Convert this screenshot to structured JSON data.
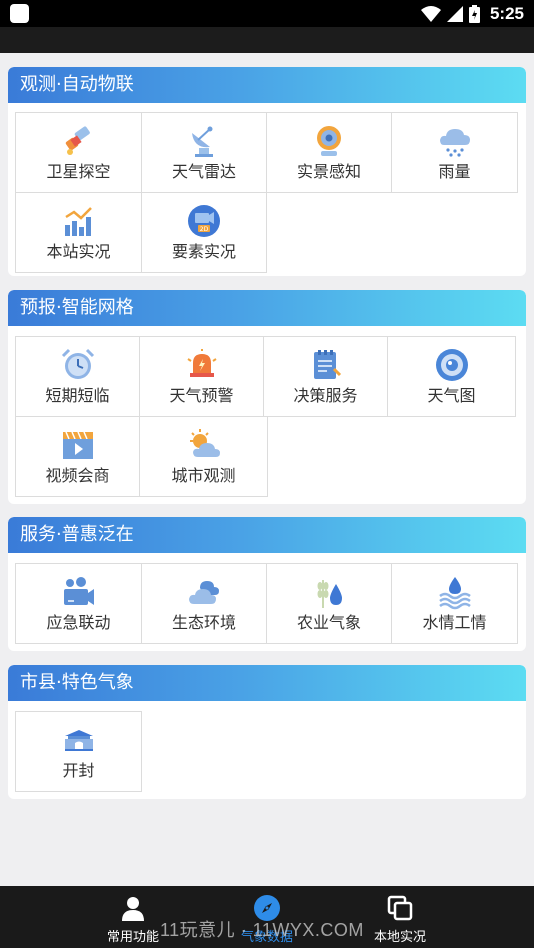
{
  "status_bar": {
    "time": "5:25"
  },
  "sections": [
    {
      "title": "观测·自动物联",
      "items": [
        {
          "label": "卫星探空",
          "icon": "satellite-icon"
        },
        {
          "label": "天气雷达",
          "icon": "radar-dish-icon"
        },
        {
          "label": "实景感知",
          "icon": "webcam-icon"
        },
        {
          "label": "雨量",
          "icon": "rain-cloud-icon"
        },
        {
          "label": "本站实况",
          "icon": "bar-chart-icon"
        },
        {
          "label": "要素实况",
          "icon": "video-2d-icon"
        }
      ]
    },
    {
      "title": "预报·智能网格",
      "items": [
        {
          "label": "短期短临",
          "icon": "alarm-clock-icon"
        },
        {
          "label": "天气预警",
          "icon": "alarm-bell-icon"
        },
        {
          "label": "决策服务",
          "icon": "notepad-icon"
        },
        {
          "label": "天气图",
          "icon": "eye-target-icon"
        },
        {
          "label": "视频会商",
          "icon": "video-play-icon"
        },
        {
          "label": "城市观测",
          "icon": "sun-cloud-icon"
        }
      ]
    },
    {
      "title": "服务·普惠泛在",
      "items": [
        {
          "label": "应急联动",
          "icon": "camera-people-icon"
        },
        {
          "label": "生态环境",
          "icon": "clouds-icon"
        },
        {
          "label": "农业气象",
          "icon": "wheat-drop-icon"
        },
        {
          "label": "水情工情",
          "icon": "water-waves-icon"
        }
      ]
    },
    {
      "title": "市县·特色气象",
      "items": [
        {
          "label": "开封",
          "icon": "city-gate-icon"
        }
      ]
    }
  ],
  "bottom_nav": [
    {
      "label": "常用功能",
      "icon": "person-icon",
      "active": false
    },
    {
      "label": "气象数据",
      "icon": "compass-icon",
      "active": true
    },
    {
      "label": "本地实况",
      "icon": "copy-squares-icon",
      "active": false
    }
  ],
  "watermark": "11玩意儿 · 11WYX.COM",
  "colors": {
    "header_gradient_start": "#3a7bd8",
    "header_gradient_end": "#5cdcf2",
    "nav_active": "#2e8ce8",
    "bottom_bar": "#1a1a1a"
  }
}
